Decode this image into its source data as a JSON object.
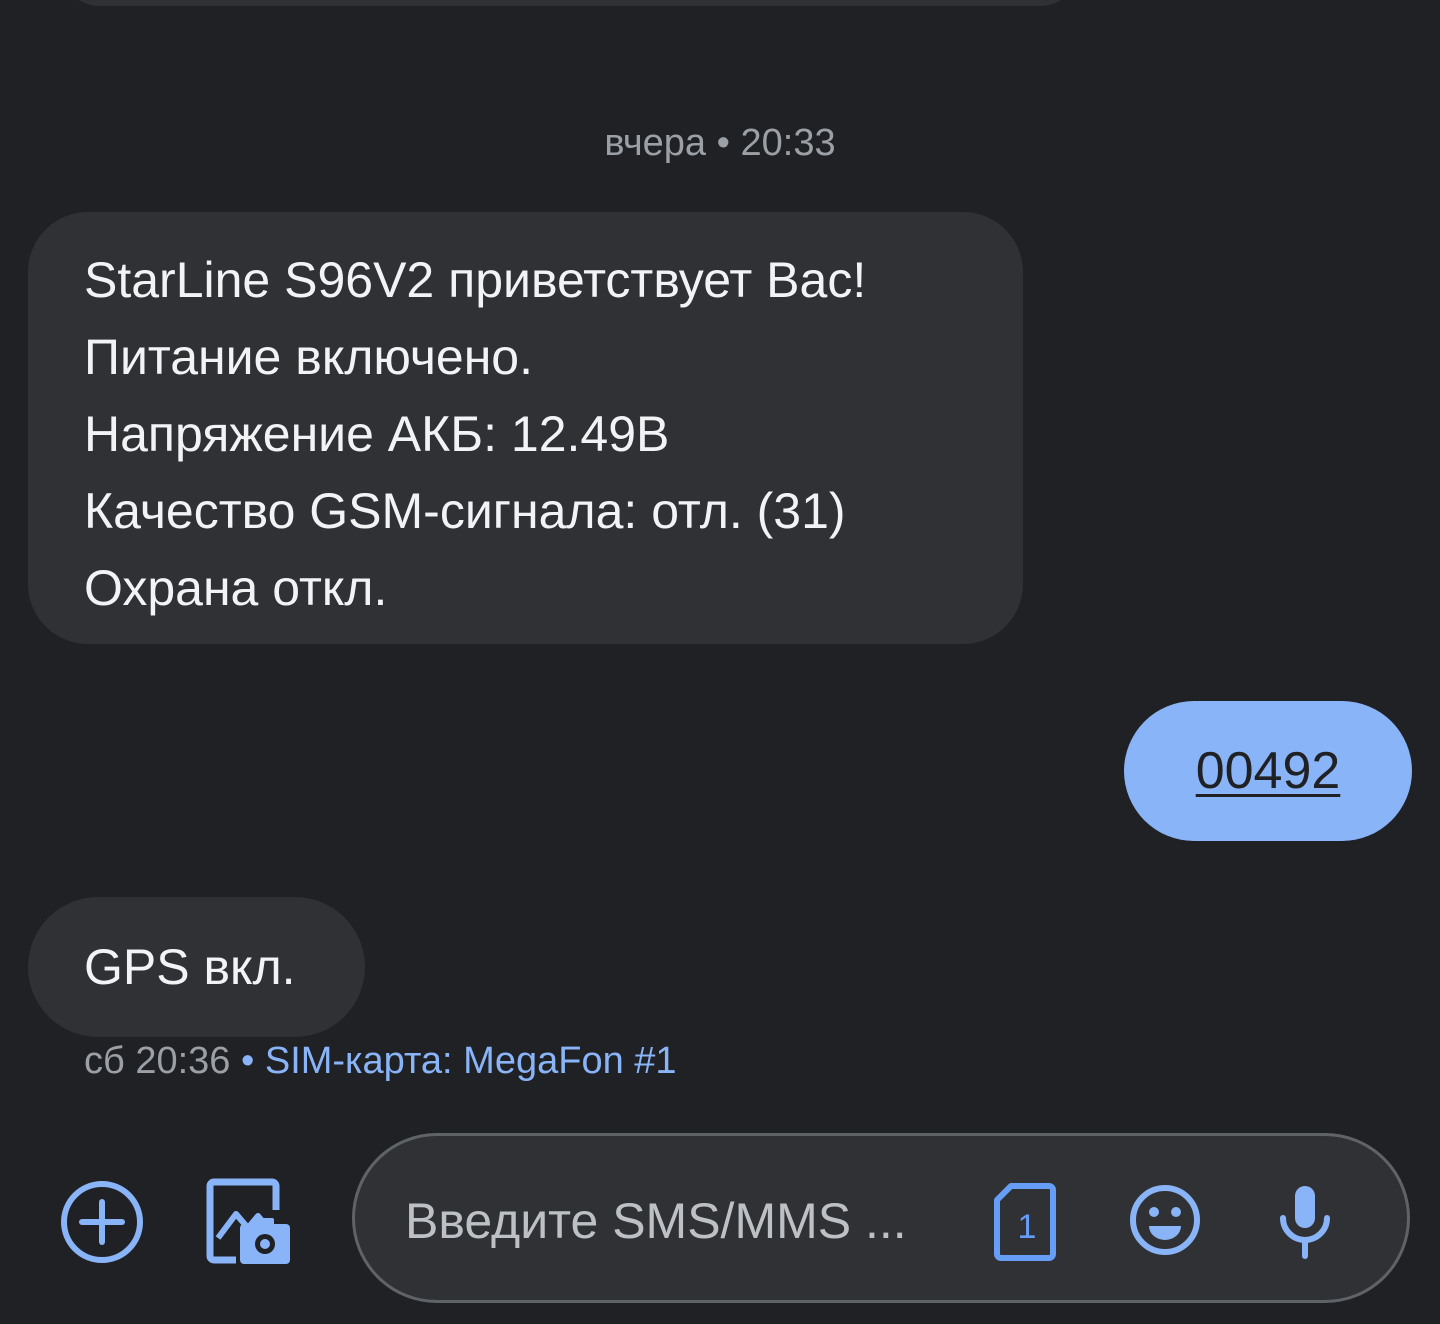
{
  "conversation": {
    "timestamp_yesterday": "вчера • 20:33",
    "incoming_1": {
      "lines": [
        "StarLine S96V2 приветствует Вас!",
        "Питание включено.",
        "Напряжение АКБ: 12.49В",
        "Качество GSM-сигнала: отл. (31)",
        "Охрана откл."
      ]
    },
    "outgoing_1": {
      "text": "00492"
    },
    "incoming_2": {
      "text": "GPS вкл."
    },
    "meta": {
      "time": "сб 20:36",
      "separator": " • ",
      "sim": "SIM-карта: MegaFon #1"
    }
  },
  "composer": {
    "placeholder": "Введите SMS/MMS ...",
    "sim_slot": "1",
    "icons": {
      "add": "add-circle-icon",
      "gallery": "gallery-camera-icon",
      "sim": "sim-card-icon",
      "emoji": "emoji-icon",
      "mic": "microphone-icon"
    }
  },
  "colors": {
    "background": "#202124",
    "incoming_bubble": "#303134",
    "outgoing_bubble": "#8ab4f8",
    "accent": "#8ab4f8",
    "secondary_text": "#9aa0a6"
  }
}
